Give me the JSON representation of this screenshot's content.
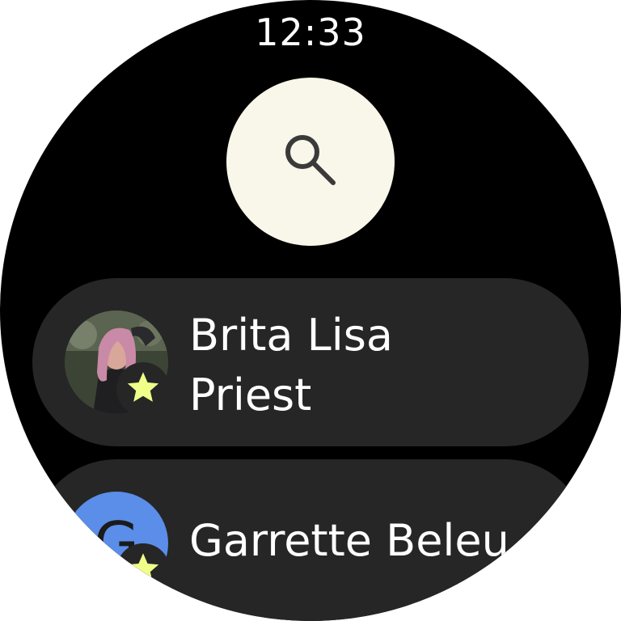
{
  "status_bar": {
    "time": "12:33"
  },
  "search": {
    "icon": "search-icon",
    "button_color": "#f9f6ea"
  },
  "contacts": [
    {
      "name_line1": "Brita Lisa",
      "name_line2": "Priest",
      "avatar_type": "photo",
      "favorite": true,
      "badge_icon": "star-icon"
    },
    {
      "name_line1": "Garrette Beleu",
      "avatar_type": "letter",
      "avatar_letter": "G",
      "avatar_color": "#5a8ee8",
      "favorite": true,
      "badge_icon": "star-icon"
    }
  ],
  "colors": {
    "background": "#000000",
    "chip": "#262626",
    "star": "#efff8a",
    "text": "#ffffff"
  }
}
